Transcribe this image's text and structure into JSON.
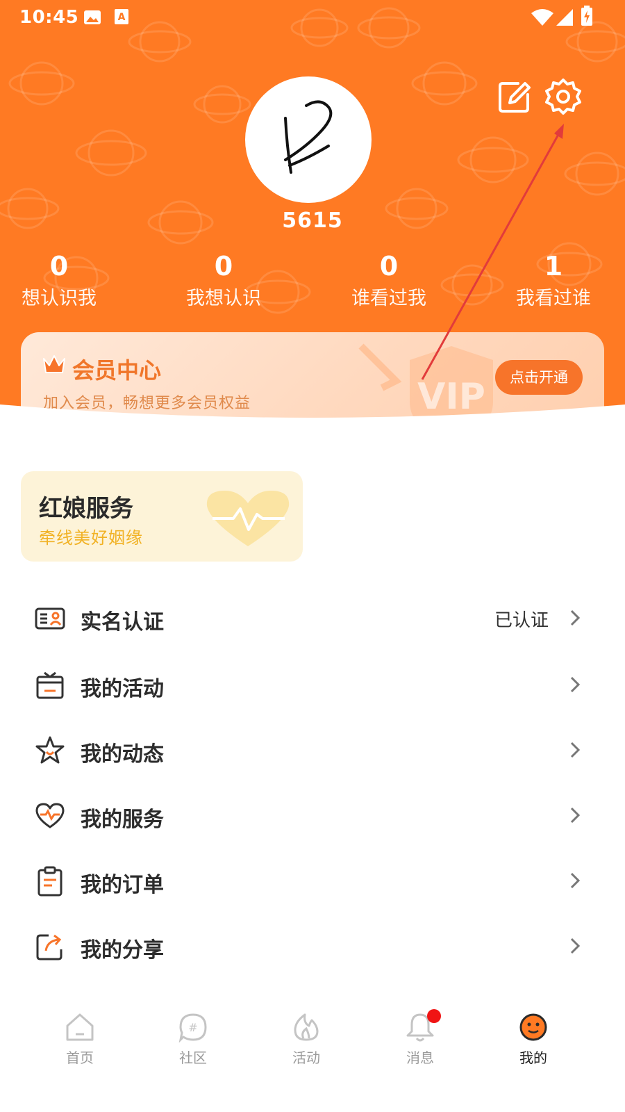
{
  "status_bar": {
    "time": "10:45",
    "icons": [
      "image-icon",
      "font-icon",
      "wifi-icon",
      "signal-icon",
      "battery-charging-icon"
    ]
  },
  "header": {
    "edit_icon": "edit-icon",
    "settings_icon": "gear-icon",
    "username": "5615",
    "stats": [
      {
        "value": "0",
        "label": "想认识我"
      },
      {
        "value": "0",
        "label": "我想认识"
      },
      {
        "value": "0",
        "label": "谁看过我"
      },
      {
        "value": "1",
        "label": "我看过谁"
      }
    ]
  },
  "vip": {
    "title": "会员中心",
    "subtitle": "加入会员，畅想更多会员权益",
    "button": "点击开通"
  },
  "matchmaker": {
    "title": "红娘服务",
    "subtitle": "牵线美好姻缘"
  },
  "menu": [
    {
      "label": "实名认证",
      "value": "已认证",
      "icon": "id-card-icon"
    },
    {
      "label": "我的活动",
      "value": "",
      "icon": "tv-icon"
    },
    {
      "label": "我的动态",
      "value": "",
      "icon": "star-icon"
    },
    {
      "label": "我的服务",
      "value": "",
      "icon": "heart-pulse-icon"
    },
    {
      "label": "我的订单",
      "value": "",
      "icon": "clipboard-icon"
    },
    {
      "label": "我的分享",
      "value": "",
      "icon": "share-icon"
    }
  ],
  "tabs": [
    {
      "label": "首页",
      "icon": "home-icon",
      "active": false
    },
    {
      "label": "社区",
      "icon": "hashtag-bubble-icon",
      "active": false
    },
    {
      "label": "活动",
      "icon": "flame-icon",
      "active": false
    },
    {
      "label": "消息",
      "icon": "bell-icon",
      "active": false,
      "badge": true
    },
    {
      "label": "我的",
      "icon": "profile-face-icon",
      "active": true
    }
  ],
  "colors": {
    "brand_orange": "#ff7a23",
    "badge_red": "#f01414",
    "match_yellow": "#f1b225"
  }
}
